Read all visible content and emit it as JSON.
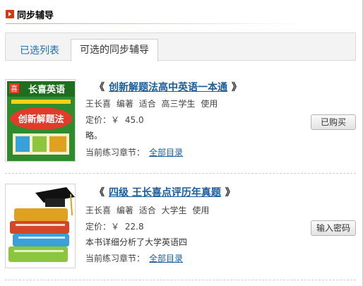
{
  "header": {
    "title": "同步辅导"
  },
  "tabs": [
    {
      "label": "已选列表"
    },
    {
      "label": "可选的同步辅导"
    }
  ],
  "books": [
    {
      "title": "创新解题法高中英语一本通",
      "quote_open": "《",
      "quote_close": "》",
      "author": "王长喜",
      "author_role": "编著",
      "suitable_label": "适合",
      "audience": "高三学生",
      "use_label": "使用",
      "price_label": "定价：",
      "currency": "￥",
      "price": "45.0",
      "description": "略。",
      "chapter_label": "当前练习章节：",
      "chapter_link": "全部目录",
      "button": "已购买",
      "cover_text_top": "长喜英语",
      "cover_text_main": "创新解题法",
      "cover_colors": {
        "bg": "#2e8b2e",
        "accent": "#e23b2a",
        "band": "#f4d21c"
      }
    },
    {
      "title": "四级 王长喜点评历年真题",
      "quote_open": "《",
      "quote_close": "》",
      "author": "王长喜",
      "author_role": "编著",
      "suitable_label": "适合",
      "audience": "大学生",
      "use_label": "使用",
      "price_label": "定价：",
      "currency": "￥",
      "price": "22.8",
      "description": "本书详细分析了大学英语四",
      "chapter_label": "当前练习章节：",
      "chapter_link": "全部目录",
      "button": "输入密码",
      "cover_colors": {
        "book1": "#d2462a",
        "book2": "#3aa0d8",
        "book3": "#8cc63f",
        "book4": "#e0a020",
        "cap": "#111111"
      }
    }
  ]
}
